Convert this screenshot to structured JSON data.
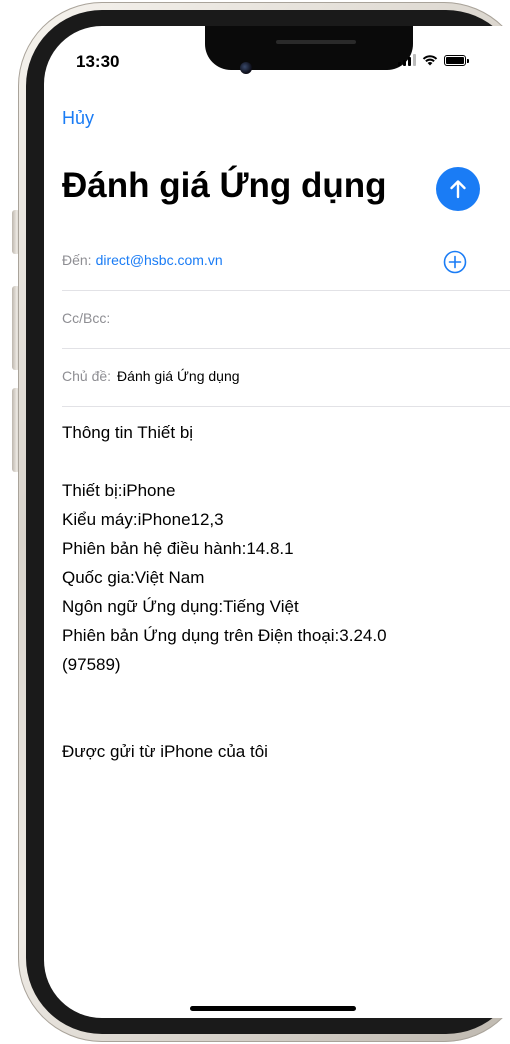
{
  "status_bar": {
    "time": "13:30"
  },
  "mail": {
    "cancel_label": "Hủy",
    "title": "Đánh giá Ứng dụng",
    "to_label": "Đến:",
    "to_value": "direct@hsbc.com.vn",
    "ccbcc_label": "Cc/Bcc:",
    "subject_label": "Chủ đề:",
    "subject_value": "Đánh giá Ứng dụng",
    "body": {
      "heading": "Thông tin Thiết bị",
      "lines": [
        "Thiết bị:iPhone",
        "Kiểu máy:iPhone12,3",
        "Phiên bản hệ điều hành:14.8.1",
        "Quốc gia:Việt Nam",
        "Ngôn ngữ Ứng dụng:Tiếng Việt",
        "Phiên bản Ứng dụng trên Điện thoại:3.24.0",
        "(97589)"
      ],
      "signature": "Được gửi từ iPhone của tôi"
    }
  },
  "icons": {
    "send": "arrow-up-icon",
    "add_recipient": "plus-circle-icon",
    "signal": "cellular-signal-icon",
    "wifi": "wifi-icon",
    "battery": "battery-icon"
  },
  "colors": {
    "accent": "#1a7cf5",
    "label_gray": "#8e8e93",
    "divider": "#e2e2e6"
  }
}
